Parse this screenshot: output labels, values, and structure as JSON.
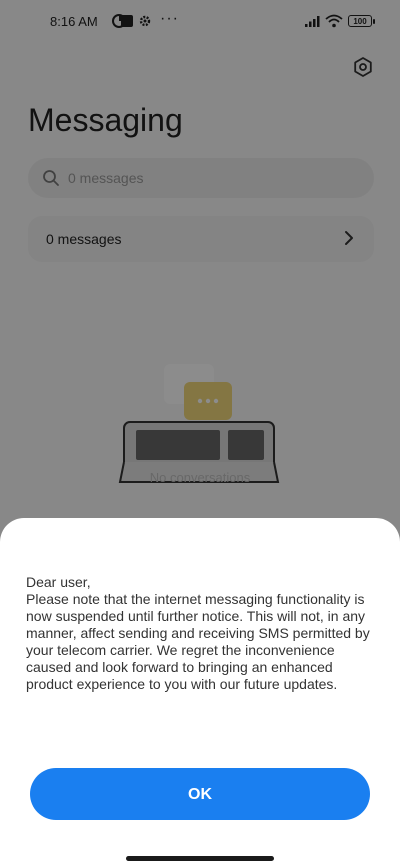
{
  "status_bar": {
    "time": "8:16 AM",
    "more": "···",
    "battery": "100",
    "icons": [
      "data-saver-icon",
      "square-app-icon",
      "gear-notification-icon",
      "signal-icon",
      "wifi-icon",
      "battery-icon"
    ]
  },
  "header": {
    "title": "Messaging",
    "settings_icon": "settings-icon"
  },
  "search": {
    "placeholder": "0 messages"
  },
  "list": {
    "row_label": "0 messages"
  },
  "empty_state": {
    "label": "No conversations"
  },
  "dialog": {
    "greeting": "Dear user,",
    "body": "Please note that the internet messaging functionality is now suspended until further notice. This will not, in any manner, affect sending and receiving SMS permitted by your telecom carrier. We regret the inconvenience caused and look forward to bringing an enhanced product experience to you with our future updates.",
    "ok_label": "OK"
  },
  "colors": {
    "accent": "#1a7ff0",
    "overlay": "rgba(0,0,0,0.45)"
  }
}
